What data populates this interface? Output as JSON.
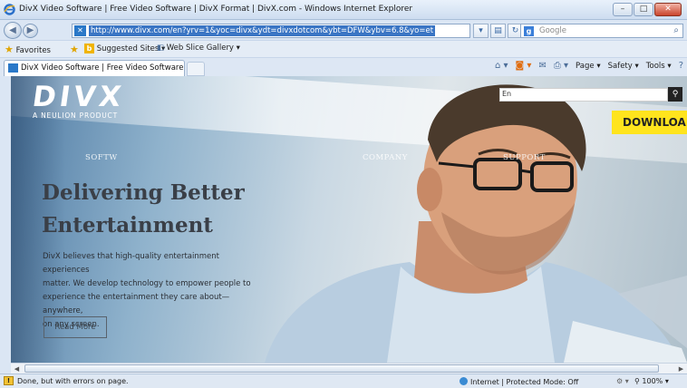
{
  "window": {
    "title": "DivX Video Software | Free Video Software | DivX Format | DivX.com - Windows Internet Explorer",
    "minimize": "–",
    "restore": "□",
    "close": "✕"
  },
  "address_bar": {
    "url": "http://www.divx.com/en?yrv=1&yoc=divx&ydt=divxdotcom&ybt=DFW&ybv=6.8&yo=et",
    "search_placeholder": "Google"
  },
  "favorites_bar": {
    "favorites_label": "Favorites",
    "suggested_sites": "Suggested Sites ▾",
    "web_slice_gallery": "Web Slice Gallery ▾"
  },
  "tab": {
    "label": "DivX Video Software | Free Video Software | DivX ..."
  },
  "command_bar": {
    "page": "Page ▾",
    "safety": "Safety ▾",
    "tools": "Tools ▾"
  },
  "site": {
    "logo": "DIVX",
    "logo_sub": "A NEULION PRODUCT",
    "search_value": "En",
    "download": "DOWNLOAD",
    "nav": [
      "SOFTW",
      "COMPANY",
      "SUPPORT"
    ],
    "headline_line1": "Delivering Better",
    "headline_line2": "Entertainment",
    "body_line1": "DivX believes that high-quality entertainment experiences",
    "body_line2": "matter. We develop technology to empower people to",
    "body_line3": "experience the entertainment they care about—anywhere,",
    "body_line4": "on any screen.",
    "read_more": "Read More"
  },
  "status_bar": {
    "message": "Done, but with errors on page.",
    "zone": "Internet | Protected Mode: Off",
    "zoom": "100%"
  },
  "colors": {
    "download_bg": "#ffe41d",
    "headline": "#3a3f47",
    "address_highlight": "#3a75c4"
  }
}
